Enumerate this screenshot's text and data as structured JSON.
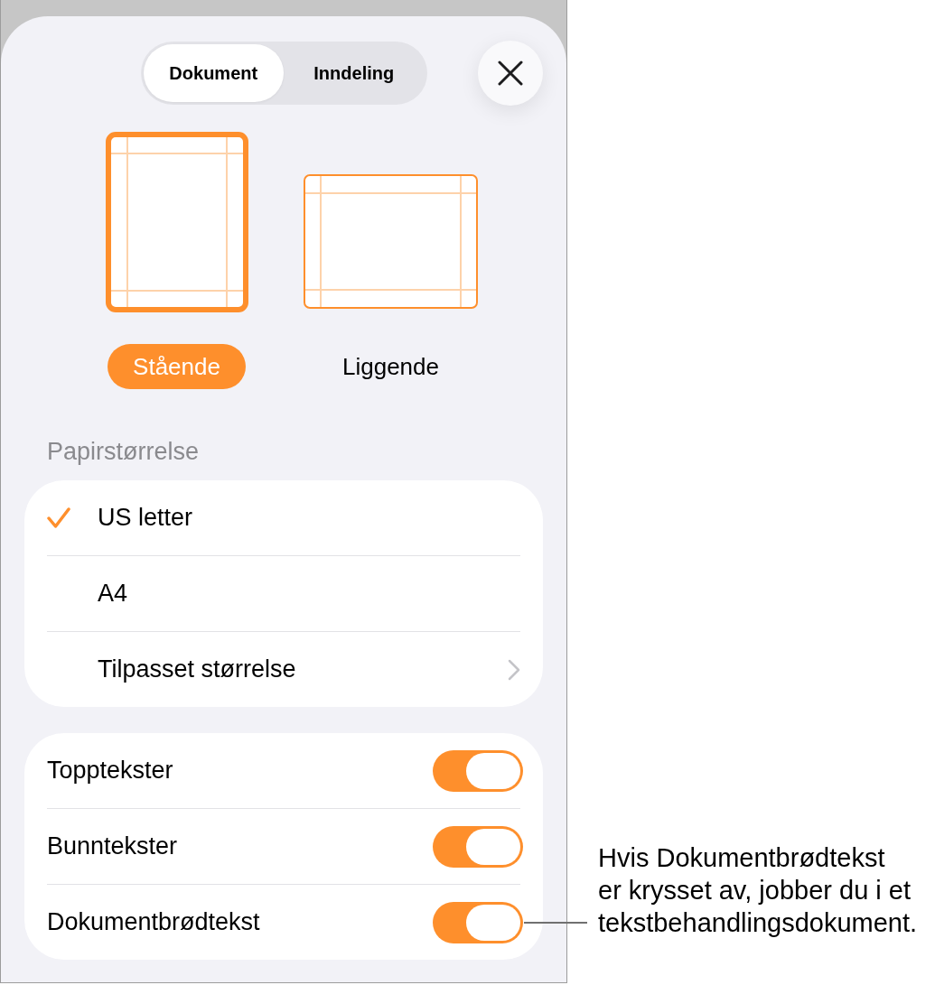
{
  "tabs": [
    {
      "label": "Dokument",
      "selected": true
    },
    {
      "label": "Inndeling",
      "selected": false
    }
  ],
  "orientations": [
    {
      "kind": "portrait",
      "label": "Stående",
      "selected": true
    },
    {
      "kind": "landscape",
      "label": "Liggende",
      "selected": false
    }
  ],
  "paper_size": {
    "heading": "Papirstørrelse",
    "options": [
      {
        "kind": "option",
        "label": "US letter",
        "selected": true
      },
      {
        "kind": "option",
        "label": "A4",
        "selected": false
      },
      {
        "kind": "disclosure",
        "label": "Tilpasset størrelse",
        "selected": false
      }
    ]
  },
  "toggles": [
    {
      "label": "Topptekster",
      "on": true
    },
    {
      "label": "Bunntekster",
      "on": true
    },
    {
      "label": "Dokumentbrødtekst",
      "on": true
    }
  ],
  "callout": {
    "lines": [
      "Hvis Dokumentbrødtekst",
      "er krysset av, jobber du i et",
      "tekstbehandlingsdokument."
    ]
  }
}
